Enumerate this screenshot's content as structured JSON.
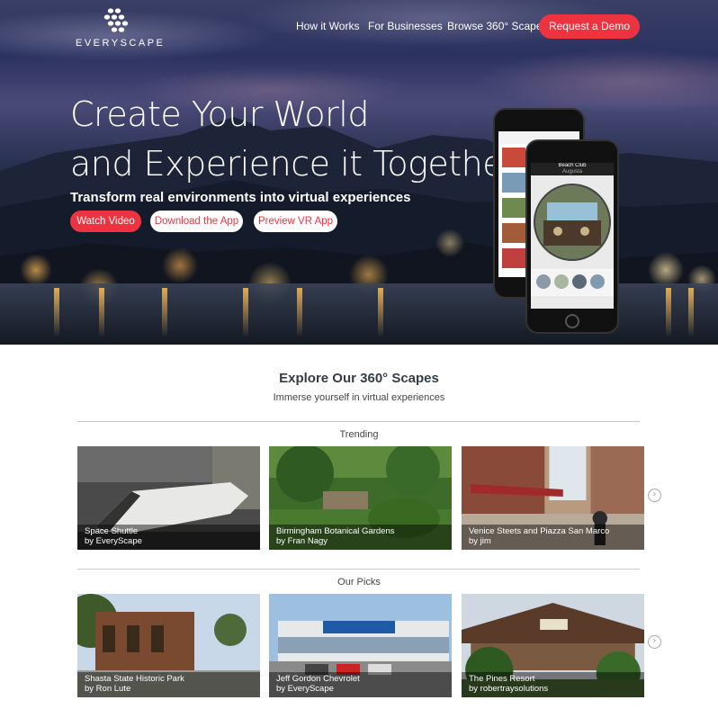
{
  "brand": {
    "name": "EVERYSCAPE"
  },
  "nav": {
    "links": [
      "How it Works",
      "For Businesses",
      "Browse 360° Scapes"
    ],
    "cta": "Request a Demo"
  },
  "hero": {
    "headline_line1": "Create Your World",
    "headline_line2": "and Experience it Together",
    "subhead": "Transform real environments into virtual experiences",
    "buttons": [
      "Watch Video",
      "Download the App",
      "Preview VR App"
    ],
    "phone": {
      "title": "Beach Club",
      "subtitle": "Augusta"
    }
  },
  "explore": {
    "title": "Explore Our 360° Scapes",
    "subtitle": "Immerse yourself in virtual experiences",
    "trending": {
      "label": "Trending",
      "cards": [
        {
          "title": "Space Shuttle",
          "author": "by EveryScape"
        },
        {
          "title": "Birmingham Botanical Gardens",
          "author": "by Fran Nagy"
        },
        {
          "title": "Venice Steets and Piazza San Marco",
          "author": "by jim"
        }
      ]
    },
    "picks": {
      "label": "Our Picks",
      "cards": [
        {
          "title": "Shasta State Historic Park",
          "author": "by Ron Lute"
        },
        {
          "title": "Jeff Gordon Chevrolet",
          "author": "by EveryScape"
        },
        {
          "title": "The Pines Resort",
          "author": "by robertraysolutions"
        }
      ]
    },
    "carousel_arrow": "›"
  },
  "colors": {
    "accent": "#ee3340",
    "text_dark": "#333d47"
  }
}
